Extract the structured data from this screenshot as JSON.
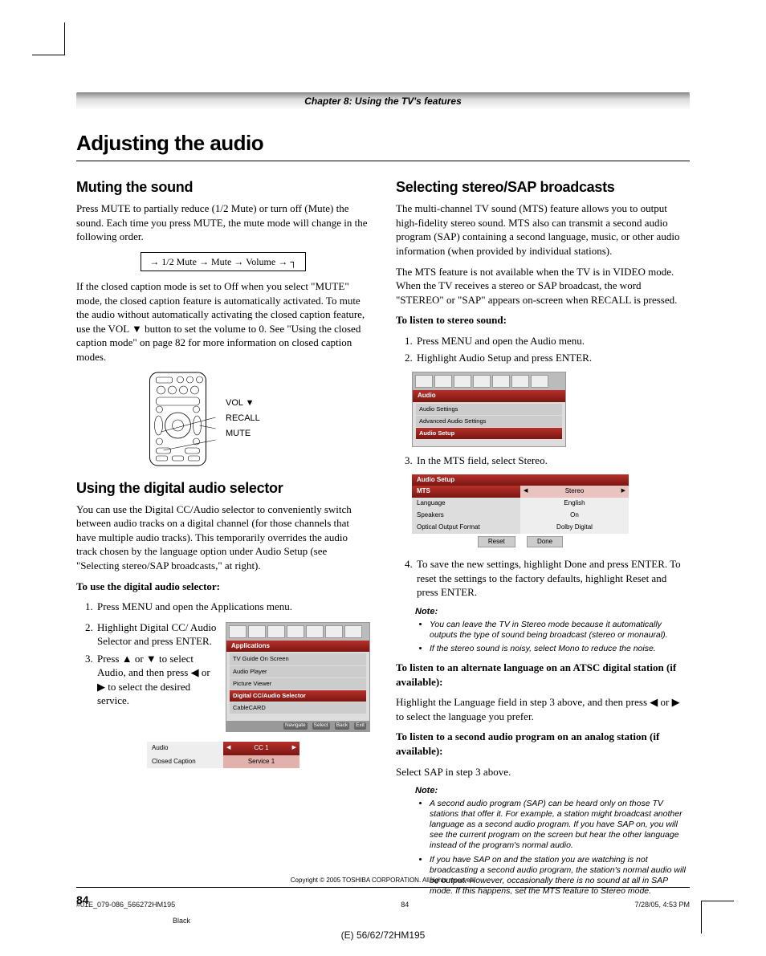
{
  "chapter_bar": "Chapter 8: Using the TV's features",
  "page_title": "Adjusting the audio",
  "left": {
    "h_mute": "Muting the sound",
    "mute_p1": "Press MUTE to partially reduce (1/2 Mute) or turn off (Mute) the sound. Each time you press MUTE, the mute mode will change in the following order.",
    "cycle": "→ 1/2 Mute → Mute → Volume → ┐",
    "mute_p2": "If the closed caption mode is set to Off when you select \"MUTE\" mode, the closed caption feature is automatically activated. To mute the audio without automatically activating the closed caption feature, use the VOL ▼ button to set the volume to 0. See \"Using the closed caption mode\" on page 82 for more information on closed caption modes.",
    "remote_labels": {
      "vol": "VOL ▼",
      "recall": "RECALL",
      "mute": "MUTE"
    },
    "h_digital": "Using the digital audio selector",
    "digital_p1": "You can use the Digital CC/Audio selector to conveniently switch between audio tracks on a digital channel (for those channels that have multiple audio tracks). This temporarily overrides the audio track chosen by the language option under Audio Setup (see \"Selecting stereo/SAP broadcasts,\" at right).",
    "digital_bold": "To use the digital audio selector:",
    "digital_steps": {
      "s1": "Press MENU and open the Applications menu.",
      "s2": "Highlight Digital CC/ Audio Selector and press ENTER.",
      "s3": "Press ▲ or ▼ to select Audio, and then press ◀ or ▶ to select the desired service."
    },
    "apps_menu": {
      "title": "Applications",
      "items": [
        "TV Guide On Screen",
        "Audio Player",
        "Picture Viewer",
        "Digital CC/Audio Selector",
        "CableCARD"
      ],
      "footer": [
        "Navigate",
        "Select",
        "Back",
        "Exit"
      ]
    },
    "selector": {
      "r1": {
        "label": "Audio",
        "value": "CC 1"
      },
      "r2": {
        "label": "Closed Caption",
        "value": "Service 1"
      }
    }
  },
  "right": {
    "h_sap": "Selecting stereo/SAP broadcasts",
    "sap_p1": "The multi-channel TV sound (MTS) feature allows you to output high-fidelity stereo sound. MTS also can transmit a second audio program (SAP) containing a second language, music, or other audio information (when provided by individual stations).",
    "sap_p2": "The MTS feature is not available when the TV is in VIDEO mode. When the TV receives a stereo or SAP broadcast, the word \"STEREO\" or \"SAP\" appears on-screen when RECALL is pressed.",
    "stereo_bold": "To listen to stereo sound:",
    "stereo_steps": {
      "s1": "Press MENU and open the Audio menu.",
      "s2": "Highlight Audio Setup and press ENTER.",
      "s3": "In the MTS field, select Stereo.",
      "s4": "To save the new settings, highlight Done and press ENTER. To reset the settings to the factory defaults, highlight Reset and press ENTER."
    },
    "audio_menu": {
      "title": "Audio",
      "items": [
        "Audio Settings",
        "Advanced Audio Settings",
        "Audio Setup"
      ]
    },
    "audio_setup": {
      "title": "Audio Setup",
      "rows": [
        {
          "label": "MTS",
          "value": "Stereo",
          "sel": true
        },
        {
          "label": "Language",
          "value": "English"
        },
        {
          "label": "Speakers",
          "value": "On"
        },
        {
          "label": "Optical Output Format",
          "value": "Dolby Digital"
        }
      ],
      "buttons": [
        "Reset",
        "Done"
      ]
    },
    "note1_head": "Note:",
    "note1": [
      "You can leave the TV in Stereo mode because it automatically outputs the type of sound being broadcast (stereo or monaural).",
      "If the stereo sound is noisy, select Mono to reduce the noise."
    ],
    "atsc_bold": "To listen to an alternate language on an ATSC digital station (if available):",
    "atsc_p": "Highlight the Language field in step 3 above, and then press ◀ or ▶ to select the language you prefer.",
    "analog_bold": "To listen to a second audio program on an analog station (if available):",
    "analog_p": "Select SAP in step 3 above.",
    "note2_head": "Note:",
    "note2": [
      "A second audio program (SAP) can be heard only on those TV stations that offer it. For example, a station might broadcast another language as a second audio program. If you have SAP on, you will see the current program on the screen but hear the other language instead of the program's normal audio.",
      "If you have SAP on and the station you are watching is not broadcasting a second audio program, the station's normal audio will be output. However, occasionally there is no sound at all in SAP mode. If this happens, set the MTS feature to Stereo mode."
    ]
  },
  "footer": {
    "copyright": "Copyright © 2005 TOSHIBA CORPORATION. All rights reserved.",
    "page_num": "84",
    "file": "#01E_079-086_566272HM195",
    "pg": "84",
    "date": "7/28/05, 4:53 PM",
    "black": "Black",
    "model": "(E) 56/62/72HM195"
  }
}
